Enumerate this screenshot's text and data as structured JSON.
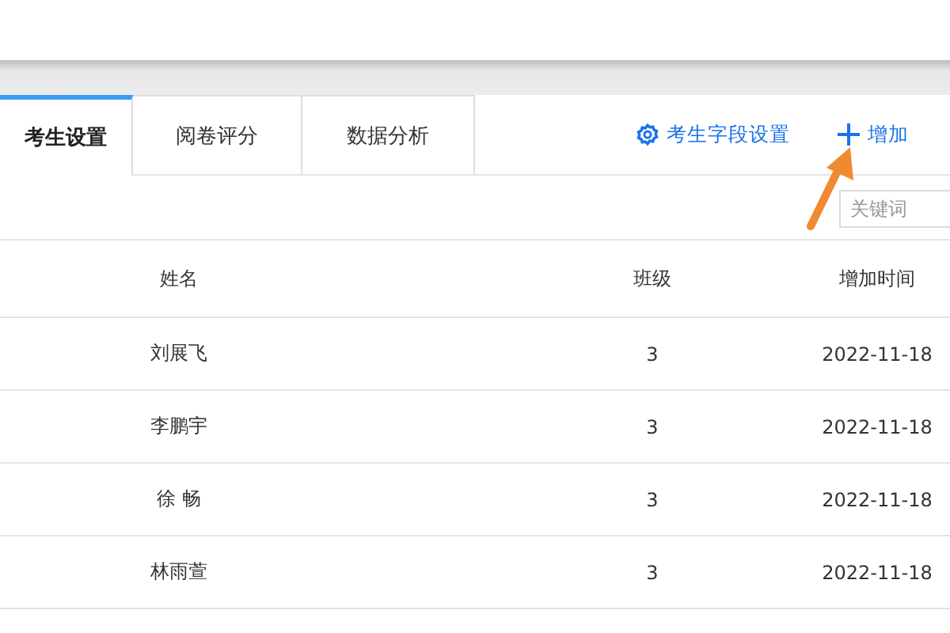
{
  "tabs": [
    {
      "label": "考生设置",
      "selected": true
    },
    {
      "label": "阅卷评分",
      "selected": false
    },
    {
      "label": "数据分析",
      "selected": false
    }
  ],
  "actions": [
    {
      "kind": "settings",
      "label": "考生字段设置"
    },
    {
      "kind": "add",
      "label": "增加"
    }
  ],
  "search": {
    "placeholder": "关键词"
  },
  "table": {
    "columns": [
      "姓名",
      "班级",
      "增加时间"
    ],
    "rows": [
      [
        "刘展飞",
        "3",
        "2022-11-18"
      ],
      [
        "李鹏宇",
        "3",
        "2022-11-18"
      ],
      [
        "徐 畅",
        "3",
        "2022-11-18"
      ],
      [
        "林雨萱",
        "3",
        "2022-11-18"
      ]
    ]
  }
}
